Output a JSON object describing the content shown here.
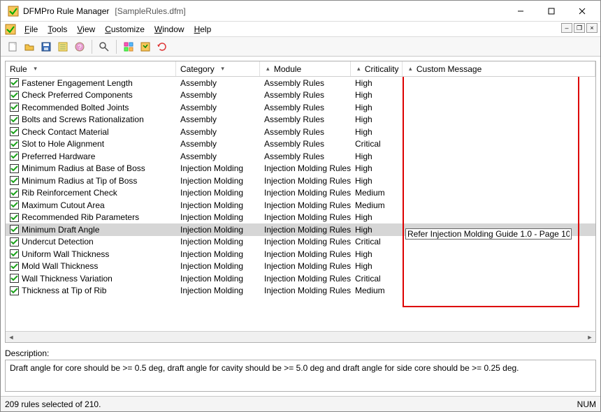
{
  "window": {
    "title": "DFMPro Rule Manager",
    "document": "[SampleRules.dfm]"
  },
  "menus": [
    "File",
    "Tools",
    "View",
    "Customize",
    "Window",
    "Help"
  ],
  "columns": {
    "rule": "Rule",
    "category": "Category",
    "module": "Module",
    "criticality": "Criticality",
    "custom_message": "Custom Message"
  },
  "rows": [
    {
      "checked": true,
      "rule": "Fastener Engagement Length",
      "category": "Assembly",
      "module": "Assembly Rules",
      "criticality": "High"
    },
    {
      "checked": true,
      "rule": "Check Preferred Components",
      "category": "Assembly",
      "module": "Assembly Rules",
      "criticality": "High"
    },
    {
      "checked": true,
      "rule": "Recommended Bolted Joints",
      "category": "Assembly",
      "module": "Assembly Rules",
      "criticality": "High"
    },
    {
      "checked": true,
      "rule": "Bolts and Screws Rationalization",
      "category": "Assembly",
      "module": "Assembly Rules",
      "criticality": "High"
    },
    {
      "checked": true,
      "rule": "Check Contact Material",
      "category": "Assembly",
      "module": "Assembly Rules",
      "criticality": "High"
    },
    {
      "checked": true,
      "rule": "Slot to Hole Alignment",
      "category": "Assembly",
      "module": "Assembly Rules",
      "criticality": "Critical"
    },
    {
      "checked": true,
      "rule": "Preferred Hardware",
      "category": "Assembly",
      "module": "Assembly Rules",
      "criticality": "High"
    },
    {
      "checked": true,
      "rule": "Minimum Radius at Base of Boss",
      "category": "Injection Molding",
      "module": "Injection Molding Rules",
      "criticality": "High"
    },
    {
      "checked": true,
      "rule": "Minimum Radius at Tip of Boss",
      "category": "Injection Molding",
      "module": "Injection Molding Rules",
      "criticality": "High"
    },
    {
      "checked": true,
      "rule": "Rib Reinforcement Check",
      "category": "Injection Molding",
      "module": "Injection Molding Rules",
      "criticality": "Medium"
    },
    {
      "checked": true,
      "rule": "Maximum Cutout Area",
      "category": "Injection Molding",
      "module": "Injection Molding Rules",
      "criticality": "Medium"
    },
    {
      "checked": true,
      "rule": "Recommended Rib Parameters",
      "category": "Injection Molding",
      "module": "Injection Molding Rules",
      "criticality": "High"
    },
    {
      "checked": true,
      "rule": "Minimum Draft Angle",
      "category": "Injection Molding",
      "module": "Injection Molding Rules",
      "criticality": "High",
      "selected": true,
      "message": "Refer Injection Molding Guide 1.0 - Page 10"
    },
    {
      "checked": true,
      "rule": "Undercut Detection",
      "category": "Injection Molding",
      "module": "Injection Molding Rules",
      "criticality": "Critical"
    },
    {
      "checked": true,
      "rule": "Uniform Wall Thickness",
      "category": "Injection Molding",
      "module": "Injection Molding Rules",
      "criticality": "High"
    },
    {
      "checked": true,
      "rule": "Mold Wall Thickness",
      "category": "Injection Molding",
      "module": "Injection Molding Rules",
      "criticality": "High"
    },
    {
      "checked": true,
      "rule": "Wall Thickness Variation",
      "category": "Injection Molding",
      "module": "Injection Molding Rules",
      "criticality": "Critical"
    },
    {
      "checked": true,
      "rule": "Thickness at Tip of Rib",
      "category": "Injection Molding",
      "module": "Injection Molding Rules",
      "criticality": "Medium"
    }
  ],
  "description": {
    "label": "Description:",
    "text": "Draft angle for core should be >= 0.5 deg, draft angle for cavity should be >= 5.0 deg and draft angle for side core should be >= 0.25 deg."
  },
  "status": {
    "left": "209 rules selected of 210.",
    "right": "NUM"
  },
  "edit_value": "Refer Injection Molding Guide 1.0 - Page 10"
}
